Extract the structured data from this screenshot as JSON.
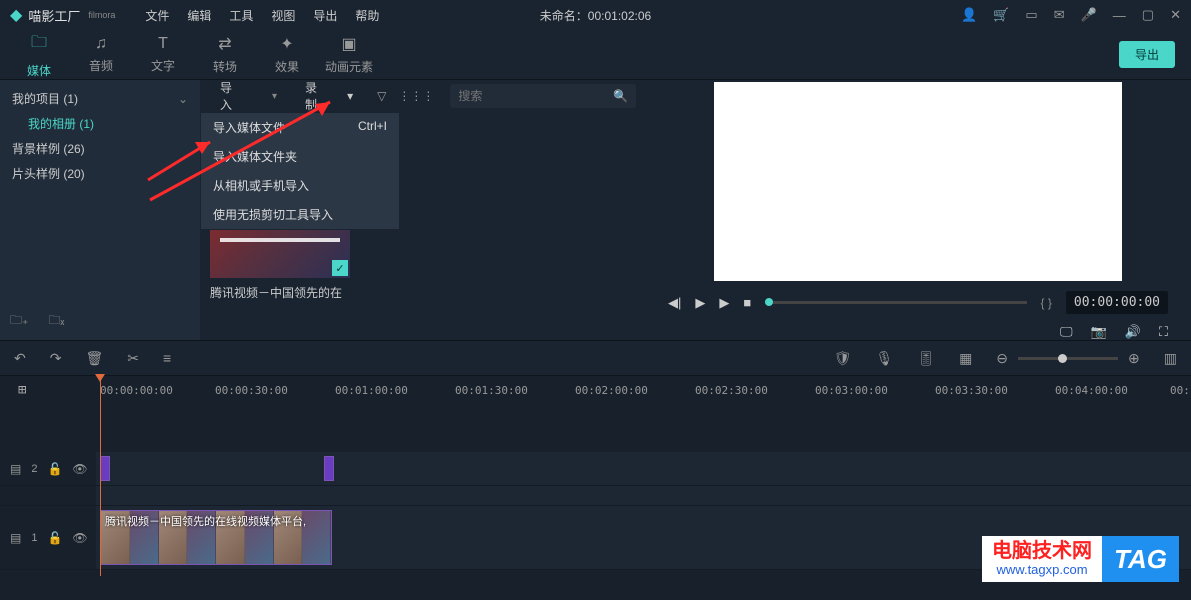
{
  "app": {
    "name": "喵影工厂",
    "sub": "filmora"
  },
  "menu": [
    "文件",
    "编辑",
    "工具",
    "视图",
    "导出",
    "帮助"
  ],
  "title_center": "未命名：00:01:02:06",
  "title_icons": [
    "user",
    "cart",
    "box",
    "mail",
    "mic",
    "min",
    "max",
    "close"
  ],
  "tabs": [
    {
      "icon": "folder",
      "label": "媒体",
      "active": true
    },
    {
      "icon": "music",
      "label": "音频"
    },
    {
      "icon": "text",
      "label": "文字"
    },
    {
      "icon": "trans",
      "label": "转场"
    },
    {
      "icon": "fx",
      "label": "效果"
    },
    {
      "icon": "anim",
      "label": "动画元素"
    }
  ],
  "export_btn": "导出",
  "sidebar": {
    "project_head": "我的项目 (1)",
    "project_sub": "我的相册 (1)",
    "bg": "背景样例 (26)",
    "intro": "片头样例 (20)"
  },
  "importbar": {
    "import": "导入",
    "record": "录制",
    "search_placeholder": "搜索"
  },
  "import_menu": [
    {
      "label": "导入媒体文件",
      "accel": "Ctrl+I"
    },
    {
      "label": "导入媒体文件夹",
      "accel": ""
    },
    {
      "label": "从相机或手机导入",
      "accel": ""
    },
    {
      "label": "使用无损剪切工具导入",
      "accel": ""
    }
  ],
  "media": {
    "thumb_caption": "腾讯视频－中国领先的在"
  },
  "preview": {
    "timecode": "00:00:00:00",
    "braces": "{  }"
  },
  "timeline": {
    "labels": [
      "00:00:00:00",
      "00:00:30:00",
      "00:01:00:00",
      "00:01:30:00",
      "00:02:00:00",
      "00:02:30:00",
      "00:03:00:00",
      "00:03:30:00",
      "00:04:00:00",
      "00:"
    ],
    "track2_num": "2",
    "track1_num": "1",
    "clip_title": "腾讯视频－中国领先的在线视频媒体平台,"
  },
  "watermark": {
    "red": "电脑技术网",
    "blue": "www.tagxp.com",
    "tag": "TAG"
  }
}
